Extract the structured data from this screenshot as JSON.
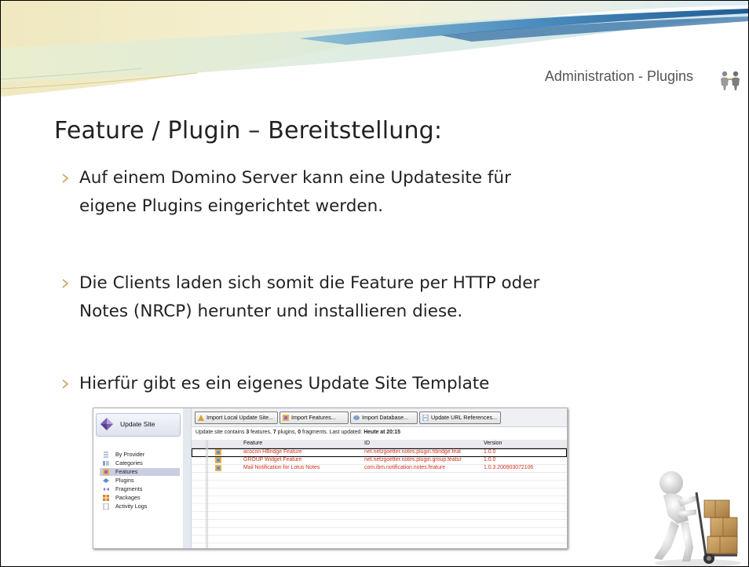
{
  "header": {
    "title": "Administration - Plugins",
    "icon": "people-icon"
  },
  "slide": {
    "title": "Feature / Plugin – Bereitstellung:",
    "bullets": [
      {
        "line1": "Auf einem Domino Server kann eine Updatesite für",
        "line2": "eigene Plugins eingerichtet werden."
      },
      {
        "line1": "Die Clients laden sich somit die Feature per HTTP oder",
        "line2": "Notes (NRCP) herunter und installieren diese."
      },
      {
        "line1": "Hierfür gibt es ein eigenes Update Site Template",
        "line2": ""
      }
    ]
  },
  "screenshot": {
    "site_title": "Update Site",
    "nav_items": [
      {
        "label": "By Provider",
        "icon": "provider-icon",
        "selected": false
      },
      {
        "label": "Categories",
        "icon": "categories-icon",
        "selected": false
      },
      {
        "label": "Features",
        "icon": "features-icon",
        "selected": true
      },
      {
        "label": "Plugins",
        "icon": "plugins-icon",
        "selected": false
      },
      {
        "label": "Fragments",
        "icon": "fragments-icon",
        "selected": false
      },
      {
        "label": "Packages",
        "icon": "packages-icon",
        "selected": false
      },
      {
        "label": "Activity Logs",
        "icon": "logs-icon",
        "selected": false
      }
    ],
    "toolbar": [
      {
        "label": "Import Local Update Site...",
        "icon": "import-site-icon"
      },
      {
        "label": "Import Features...",
        "icon": "import-features-icon"
      },
      {
        "label": "Import Database...",
        "icon": "import-database-icon"
      },
      {
        "label": "Update URL References...",
        "icon": "update-url-icon"
      }
    ],
    "info": {
      "prefix": "Update site contains ",
      "features_count": "3",
      "features_word": " features, ",
      "plugins_count": "7",
      "plugins_word": " plugins, ",
      "fragments_count": "0",
      "fragments_word": " fragments. Last updated: ",
      "updated": "Heute at 20:15"
    },
    "columns": [
      "Feature",
      "ID",
      "Version"
    ],
    "rows": [
      {
        "feature": "acocon HBridge Feature",
        "id": "net.netzgoetter.notes.plugin.hbridge.feat",
        "version": "1.0.0"
      },
      {
        "feature": "GROUP Widget Feature",
        "id": "net.netzgoetter.notes.plugin.group.featur",
        "version": "1.0.0"
      },
      {
        "feature": "Mail Notification for Lotus Notes",
        "id": "com.ibm.notification.notes.feature",
        "version": "1.0.3.200903072106"
      }
    ],
    "row_color": "#d2321e"
  },
  "decor": {
    "header_colors": [
      "#f3efc4",
      "#b9dce8",
      "#2f6fa8"
    ],
    "porter_icon": "porter-with-boxes-icon"
  }
}
